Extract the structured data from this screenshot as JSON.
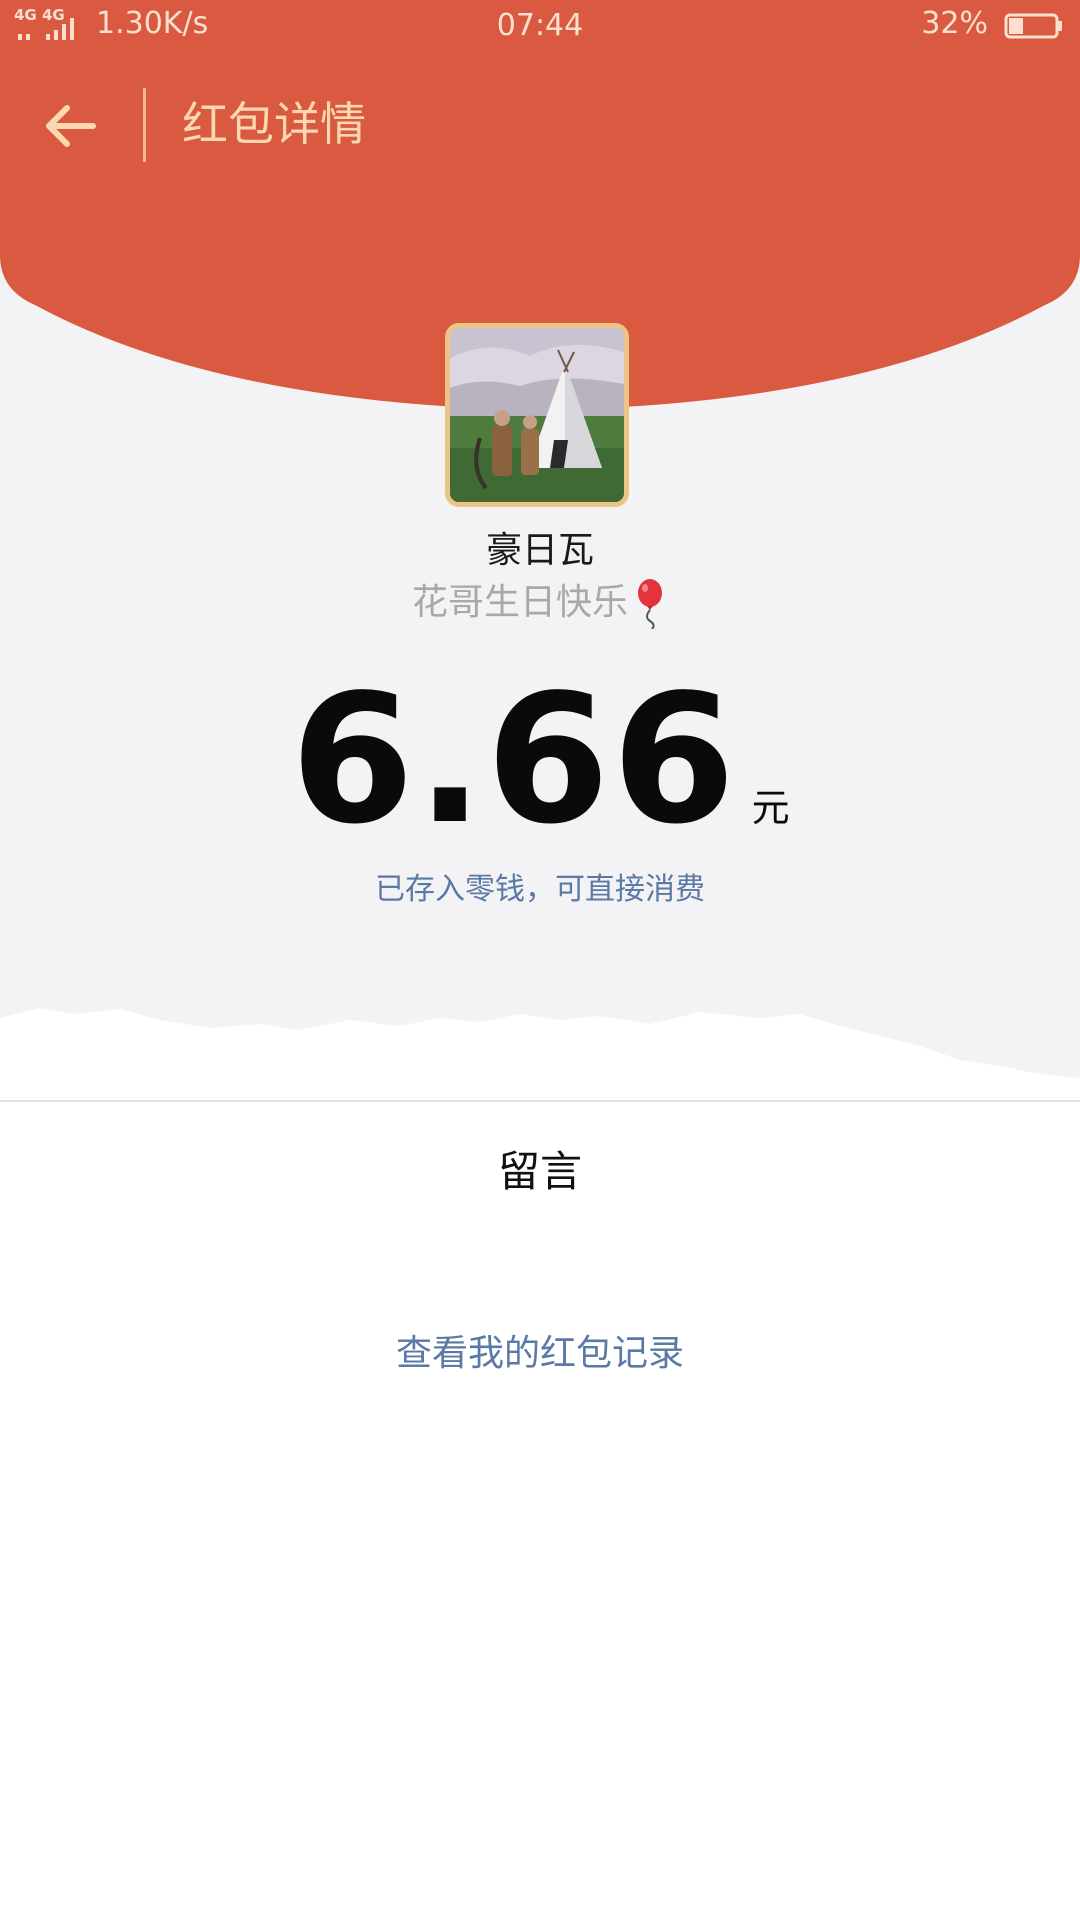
{
  "status_bar": {
    "network_badge": "4G 4G",
    "net_speed": "1.30K/s",
    "time": "07:44",
    "battery": "32%",
    "battery_level": 0.32,
    "signal_icon": "signal-bars-icon",
    "battery_icon": "battery-icon"
  },
  "nav": {
    "back_icon": "arrow-left-icon",
    "title": "红包详情"
  },
  "packet": {
    "sender_name": "豪日瓦",
    "greeting": "花哥生日快乐",
    "greeting_emoji": "balloon-icon",
    "amount": "6.66",
    "currency": "元",
    "stored_note": "已存入零钱，可直接消费"
  },
  "messages": {
    "title": "留言"
  },
  "footer": {
    "records_link": "查看我的红包记录"
  },
  "colors": {
    "header_red": "#d95a40",
    "nav_accent": "#fbd8b0",
    "link_blue": "#5a79a6",
    "avatar_border": "#edc487",
    "page_grey": "#f3f2f4"
  }
}
